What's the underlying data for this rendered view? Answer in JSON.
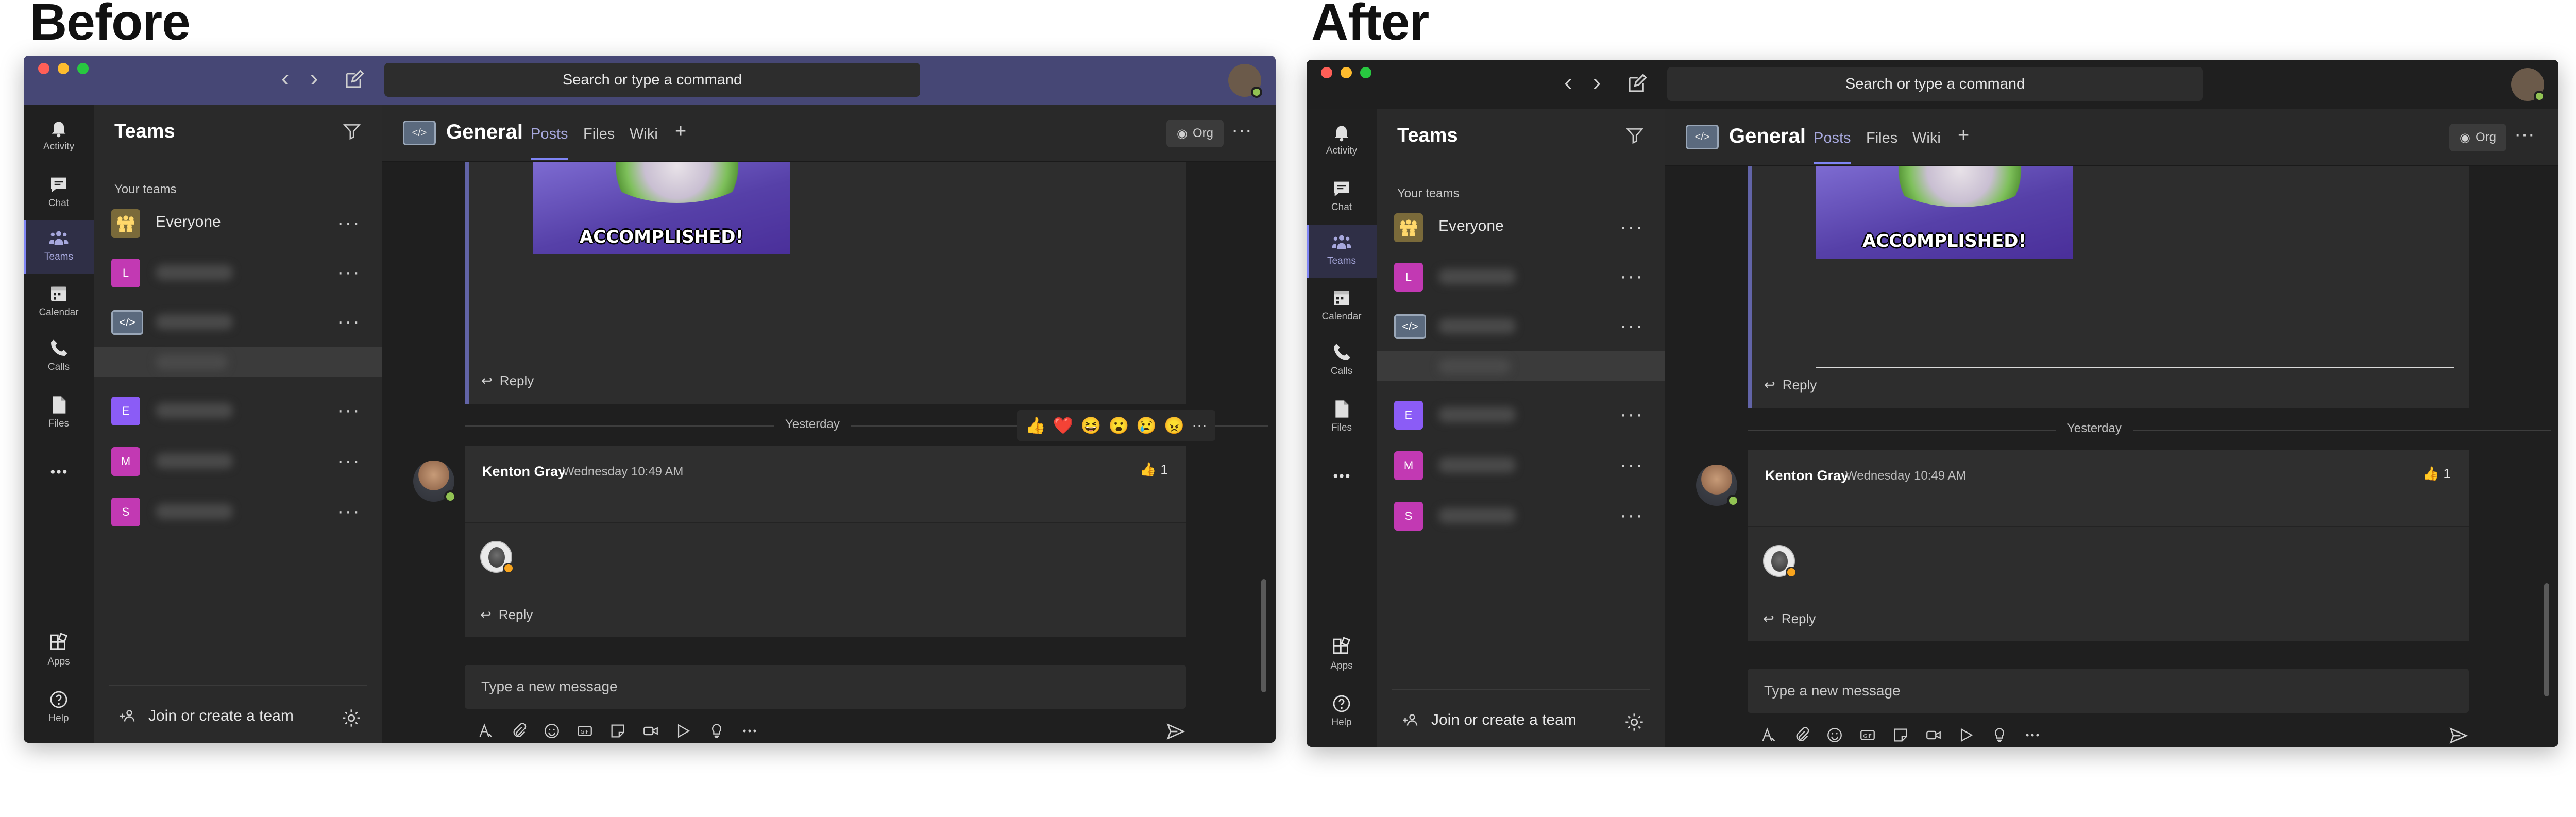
{
  "labels": {
    "before": "Before",
    "after": "After"
  },
  "search_placeholder": "Search or type a command",
  "rail": [
    {
      "label": "Activity",
      "icon": "bell-icon"
    },
    {
      "label": "Chat",
      "icon": "chat-icon"
    },
    {
      "label": "Teams",
      "icon": "teams-icon",
      "active": true
    },
    {
      "label": "Calendar",
      "icon": "calendar-icon"
    },
    {
      "label": "Calls",
      "icon": "phone-icon"
    },
    {
      "label": "Files",
      "icon": "file-icon"
    },
    {
      "label": "...",
      "icon": "more-icon"
    },
    {
      "label": "Apps",
      "icon": "apps-icon"
    },
    {
      "label": "Help",
      "icon": "help-icon"
    }
  ],
  "teams_panel": {
    "title": "Teams",
    "section": "Your teams",
    "teams": [
      {
        "name": "Everyone",
        "avatar": "",
        "color": "#7a6a3a"
      },
      {
        "name": "",
        "avatar": "L",
        "color": "#c239b3"
      },
      {
        "name": "",
        "avatar": "</>",
        "color": "#5b6a7e"
      },
      {
        "name": "",
        "avatar": "E",
        "color": "#8b5cf6"
      },
      {
        "name": "",
        "avatar": "M",
        "color": "#c239b3"
      },
      {
        "name": "",
        "avatar": "S",
        "color": "#c239b3"
      }
    ],
    "join": "Join or create a team"
  },
  "channel": {
    "icon": "</>",
    "name": "General",
    "tabs": [
      "Posts",
      "Files",
      "Wiki",
      "+"
    ],
    "org": "Org"
  },
  "posts": {
    "meme_text": "ACCOMPLISHED!",
    "reply": "Reply",
    "day_separator": "Yesterday",
    "reactions": [
      "👍",
      "❤️",
      "😆",
      "😮",
      "😢",
      "😠"
    ],
    "author": "Kenton Gray",
    "timestamp": "Wednesday 10:49 AM",
    "like_emoji": "👍",
    "like_count": "1"
  },
  "compose": {
    "placeholder": "Type a new message"
  },
  "colors": {
    "titlebar_before": "#464775",
    "titlebar_after": "#1f1f1f",
    "accent": "#7f85f5",
    "online": "#92c353"
  }
}
